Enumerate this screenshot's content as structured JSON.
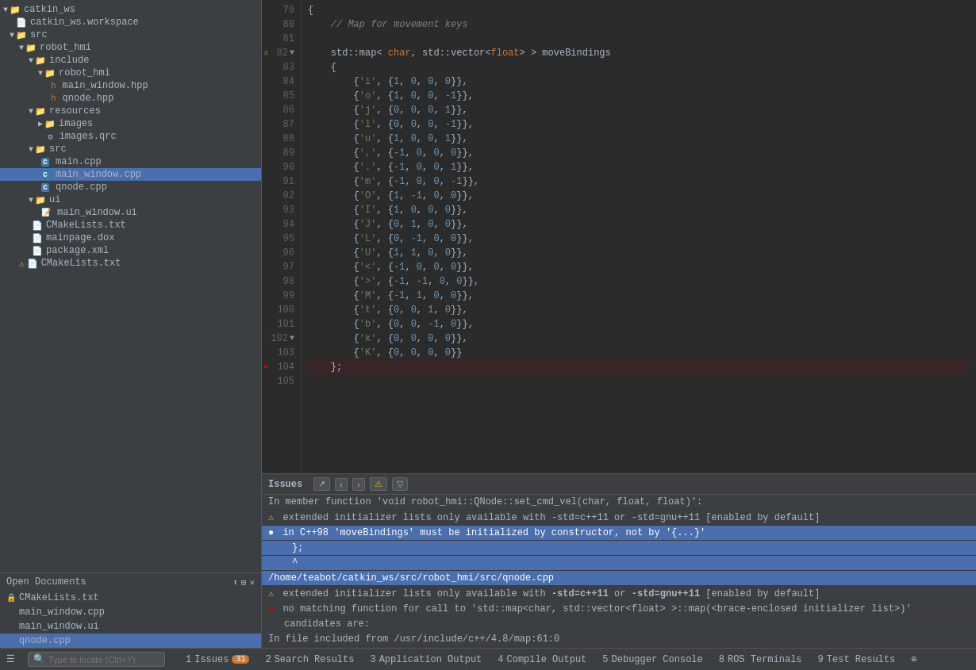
{
  "sidebar": {
    "title": "catkin_ws",
    "tree": [
      {
        "id": "catkin_ws",
        "label": "catkin_ws",
        "type": "folder",
        "level": 0,
        "expanded": true
      },
      {
        "id": "catkin_ws_workspace",
        "label": "catkin_ws.workspace",
        "type": "file",
        "level": 1
      },
      {
        "id": "src_root",
        "label": "src",
        "type": "folder",
        "level": 1,
        "expanded": true
      },
      {
        "id": "robot_hmi",
        "label": "robot_hmi",
        "type": "folder",
        "level": 2,
        "expanded": true
      },
      {
        "id": "include",
        "label": "include",
        "type": "folder",
        "level": 3,
        "expanded": true
      },
      {
        "id": "robot_hmi_inner",
        "label": "robot_hmi",
        "type": "folder",
        "level": 4,
        "expanded": true
      },
      {
        "id": "main_window_hpp",
        "label": "main_window.hpp",
        "type": "hpp",
        "level": 5
      },
      {
        "id": "qnode_hpp",
        "label": "qnode.hpp",
        "type": "hpp",
        "level": 5
      },
      {
        "id": "resources",
        "label": "resources",
        "type": "folder",
        "level": 3,
        "expanded": true
      },
      {
        "id": "images",
        "label": "images",
        "type": "folder",
        "level": 4,
        "expanded": false
      },
      {
        "id": "images_qrc",
        "label": "images.qrc",
        "type": "qrc",
        "level": 4
      },
      {
        "id": "src_inner",
        "label": "src",
        "type": "folder",
        "level": 3,
        "expanded": true
      },
      {
        "id": "main_cpp",
        "label": "main.cpp",
        "type": "cpp",
        "level": 4
      },
      {
        "id": "main_window_cpp",
        "label": "main_window.cpp",
        "type": "cpp",
        "level": 4,
        "selected": true
      },
      {
        "id": "qnode_cpp",
        "label": "qnode.cpp",
        "type": "cpp",
        "level": 4
      },
      {
        "id": "ui_folder",
        "label": "ui",
        "type": "folder",
        "level": 3,
        "expanded": true
      },
      {
        "id": "main_window_ui",
        "label": "main_window.ui",
        "type": "ui",
        "level": 4
      },
      {
        "id": "cmake_lists_robot",
        "label": "CMakeLists.txt",
        "type": "cmake",
        "level": 3
      },
      {
        "id": "mainpage_dox",
        "label": "mainpage.dox",
        "type": "file",
        "level": 3
      },
      {
        "id": "package_xml",
        "label": "package.xml",
        "type": "file",
        "level": 3
      },
      {
        "id": "cmake_lists_root",
        "label": "CMakeLists.txt",
        "type": "cmake_warning",
        "level": 2
      }
    ]
  },
  "open_docs": {
    "title": "Open Documents",
    "items": [
      {
        "label": "CMakeLists.txt",
        "locked": true,
        "selected": false
      },
      {
        "label": "main_window.cpp",
        "locked": false,
        "selected": false
      },
      {
        "label": "main_window.ui",
        "locked": false,
        "selected": false
      },
      {
        "label": "qnode.cpp",
        "locked": false,
        "selected": true
      }
    ]
  },
  "editor": {
    "lines": [
      {
        "num": 79,
        "content": "{",
        "gutter": null
      },
      {
        "num": 80,
        "content": "    // Map for movement keys",
        "gutter": null
      },
      {
        "num": 81,
        "content": "",
        "gutter": null
      },
      {
        "num": 82,
        "content": "    std::map< char, std::vector<float> > moveBindings",
        "gutter": "warning",
        "folded": true
      },
      {
        "num": 83,
        "content": "    {",
        "gutter": null
      },
      {
        "num": 84,
        "content": "        {'i', {1, 0, 0, 0}},",
        "gutter": null
      },
      {
        "num": 85,
        "content": "        {'o', {1, 0, 0, -1}},",
        "gutter": null
      },
      {
        "num": 86,
        "content": "        {'j', {0, 0, 0, 1}},",
        "gutter": null
      },
      {
        "num": 87,
        "content": "        {'l', {0, 0, 0, -1}},",
        "gutter": null
      },
      {
        "num": 88,
        "content": "        {'u', {1, 0, 0, 1}},",
        "gutter": null
      },
      {
        "num": 89,
        "content": "        {',', {-1, 0, 0, 0}},",
        "gutter": null
      },
      {
        "num": 90,
        "content": "        {'.', {-1, 0, 0, 1}},",
        "gutter": null
      },
      {
        "num": 91,
        "content": "        {'m', {-1, 0, 0, -1}},",
        "gutter": null
      },
      {
        "num": 92,
        "content": "        {'O', {1, -1, 0, 0}},",
        "gutter": null
      },
      {
        "num": 93,
        "content": "        {'I', {1, 0, 0, 0}},",
        "gutter": null
      },
      {
        "num": 94,
        "content": "        {'J', {0, 1, 0, 0}},",
        "gutter": null
      },
      {
        "num": 95,
        "content": "        {'L', {0, -1, 0, 0}},",
        "gutter": null
      },
      {
        "num": 96,
        "content": "        {'U', {1, 1, 0, 0}},",
        "gutter": null
      },
      {
        "num": 97,
        "content": "        {'<', {-1, 0, 0, 0}},",
        "gutter": null
      },
      {
        "num": 98,
        "content": "        {'>', {-1, -1, 0, 0}},",
        "gutter": null
      },
      {
        "num": 99,
        "content": "        {'M', {-1, 1, 0, 0}},",
        "gutter": null
      },
      {
        "num": 100,
        "content": "        {'t', {0, 0, 1, 0}},",
        "gutter": null
      },
      {
        "num": 101,
        "content": "        {'b', {0, 0, -1, 0}},",
        "gutter": null
      },
      {
        "num": 102,
        "content": "        {'k', {0, 0, 0, 0}},",
        "gutter": "fold"
      },
      {
        "num": 103,
        "content": "        {'K', {0, 0, 0, 0}}",
        "gutter": null
      },
      {
        "num": 104,
        "content": "    };",
        "gutter": "error"
      },
      {
        "num": 105,
        "content": "",
        "gutter": null
      }
    ]
  },
  "issues_panel": {
    "title": "Issues",
    "items": [
      {
        "type": "info",
        "text": "In member function 'void robot_hmi::QNode::set_cmd_vel(char, float, float)':",
        "indent": 0
      },
      {
        "type": "warning",
        "text": "extended initializer lists only available with -std=c++11 or -std=gnu++11 [enabled by default]",
        "indent": 0
      },
      {
        "type": "error",
        "text": "in C++98 'moveBindings' must be initialized by constructor, not by '{...}'",
        "indent": 0,
        "selected": true
      },
      {
        "type": "indent",
        "text": "    };",
        "indent": 1
      },
      {
        "type": "indent",
        "text": "    ^",
        "indent": 1
      },
      {
        "type": "path",
        "text": "/home/teabot/catkin_ws/src/robot_hmi/src/qnode.cpp",
        "indent": 0
      },
      {
        "type": "warning",
        "text": "extended initializer lists only available with -std=c++11 or -std=gnu++11 [enabled by default]",
        "indent": 0
      },
      {
        "type": "error",
        "text": "no matching function for call to 'std::map<char, std::vector<float> >::map(<brace-enclosed initializer list>)'",
        "indent": 0
      },
      {
        "type": "info",
        "text": "candidates are:",
        "indent": 1
      },
      {
        "type": "info",
        "text": "In file included from /usr/include/c++/4.8/map:61:0",
        "indent": 0
      }
    ]
  },
  "status_bar": {
    "search_placeholder": "Type to locate (Ctrl+Y)",
    "tabs": [
      {
        "num": 1,
        "label": "Issues",
        "badge": "31",
        "badge_type": "orange"
      },
      {
        "num": 2,
        "label": "Search Results",
        "badge": null
      },
      {
        "num": 3,
        "label": "Application Output",
        "badge": null
      },
      {
        "num": 4,
        "label": "Compile Output",
        "badge": null
      },
      {
        "num": 5,
        "label": "Debugger Console",
        "badge": null
      },
      {
        "num": 8,
        "label": "ROS Terminals",
        "badge": null
      },
      {
        "num": 9,
        "label": "Test Results",
        "badge": null
      }
    ]
  }
}
